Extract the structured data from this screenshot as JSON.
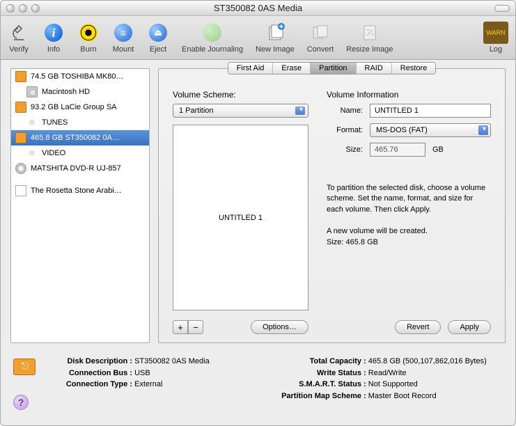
{
  "window_title": "ST350082 0AS Media",
  "toolbar": [
    {
      "label": "Verify",
      "icon": "microscope"
    },
    {
      "label": "Info",
      "icon": "info"
    },
    {
      "label": "Burn",
      "icon": "burn"
    },
    {
      "label": "Mount",
      "icon": "mount"
    },
    {
      "label": "Eject",
      "icon": "eject"
    },
    {
      "label": "Enable Journaling",
      "icon": "journal"
    },
    {
      "label": "New Image",
      "icon": "newimage"
    },
    {
      "label": "Convert",
      "icon": "convert"
    },
    {
      "label": "Resize Image",
      "icon": "resize"
    }
  ],
  "toolbar_right": {
    "label": "Log",
    "icon": "log"
  },
  "sidebar": [
    {
      "label": "74.5 GB TOSHIBA MK80…",
      "type": "disk"
    },
    {
      "label": "Macintosh HD",
      "type": "hd",
      "child": true
    },
    {
      "label": "93.2 GB LaCie Group SA",
      "type": "disk"
    },
    {
      "label": "TUNES",
      "type": "vol",
      "child": true
    },
    {
      "label": "465.8 GB ST350082 0A…",
      "type": "disk",
      "selected": true
    },
    {
      "label": "VIDEO",
      "type": "vol",
      "child": true
    },
    {
      "label": "MATSHITA DVD-R UJ-857",
      "type": "cd"
    },
    {
      "label": "",
      "type": "gap"
    },
    {
      "label": "The Rosetta Stone Arabi…",
      "type": "doc"
    }
  ],
  "tabs": [
    "First Aid",
    "Erase",
    "Partition",
    "RAID",
    "Restore"
  ],
  "active_tab": "Partition",
  "scheme_label": "Volume Scheme:",
  "scheme_value": "1 Partition",
  "partition_preview": "UNTITLED 1",
  "options_btn": "Options…",
  "volinfo_label": "Volume Information",
  "name_label": "Name:",
  "name_value": "UNTITLED 1",
  "format_label": "Format:",
  "format_value": "MS-DOS (FAT)",
  "size_label": "Size:",
  "size_value": "465.76",
  "size_unit": "GB",
  "info_text1": "To partition the selected disk, choose a volume scheme. Set the name, format, and size for each volume. Then click Apply.",
  "info_text2a": "A new volume will be created.",
  "info_text2b": "Size: 465.8 GB",
  "revert_btn": "Revert",
  "apply_btn": "Apply",
  "footer_left": {
    "desc_label": "Disk Description :",
    "desc_value": "ST350082 0AS Media",
    "bus_label": "Connection Bus :",
    "bus_value": "USB",
    "type_label": "Connection Type :",
    "type_value": "External"
  },
  "footer_right": {
    "cap_label": "Total Capacity :",
    "cap_value": "465.8 GB (500,107,862,016 Bytes)",
    "ws_label": "Write Status :",
    "ws_value": "Read/Write",
    "smart_label": "S.M.A.R.T. Status :",
    "smart_value": "Not Supported",
    "pms_label": "Partition Map Scheme :",
    "pms_value": "Master Boot Record"
  }
}
